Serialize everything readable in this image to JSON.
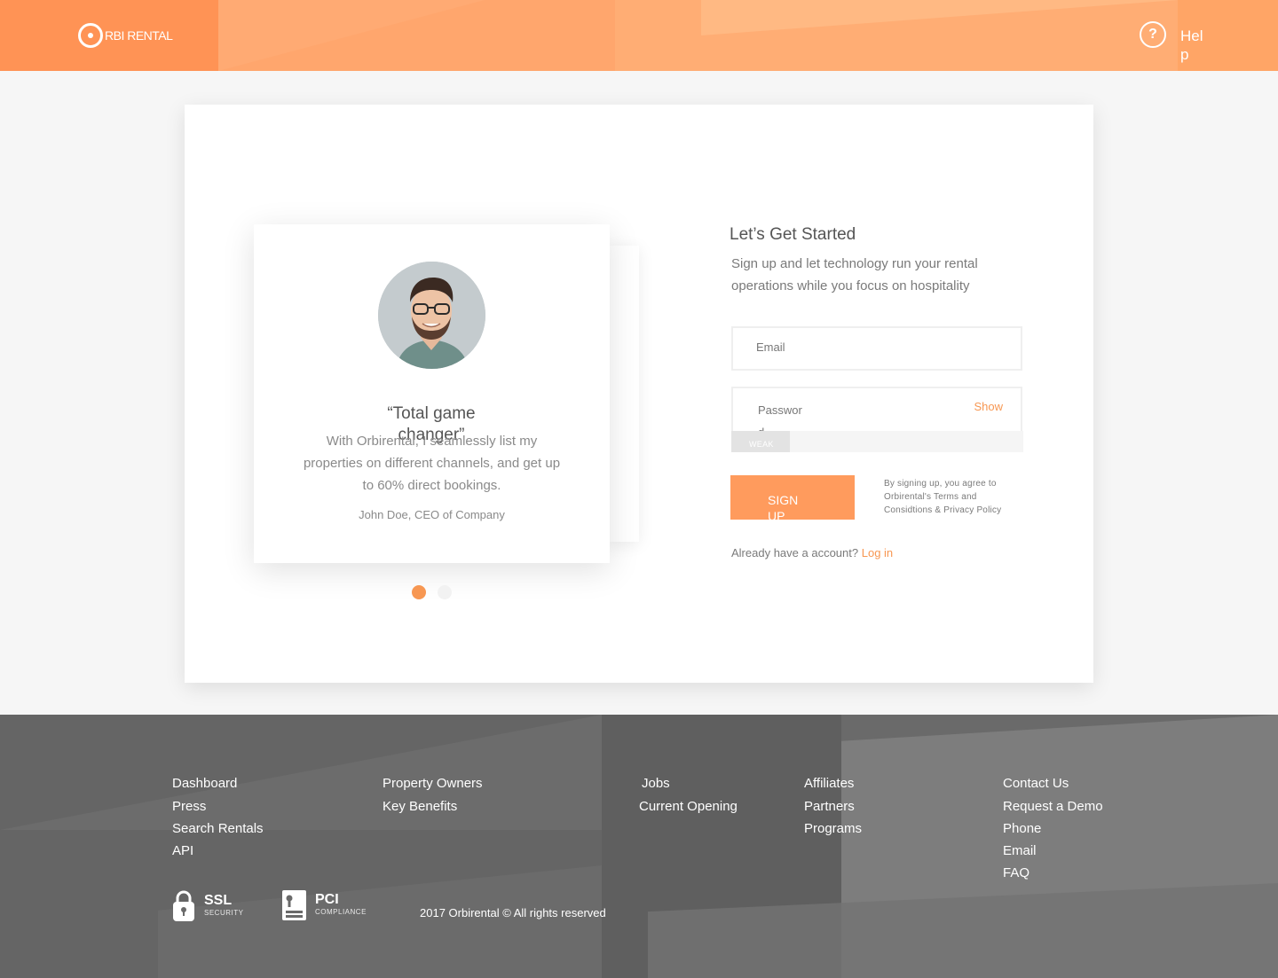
{
  "header": {
    "logo_text": "RBI RENTAL",
    "help_label": "Help"
  },
  "testimonial": {
    "quote_title": "“Total game changer”",
    "quote_body": "With Orbirental, I seamlessly list my properties on different channels, and get up to 60% direct bookings.",
    "author": "John Doe, CEO of Company",
    "slides_total": 2,
    "active_slide": 1
  },
  "form": {
    "title": "Let’s Get Started",
    "subtitle": "Sign up and let technology run your rental operations while you focus on hospitality",
    "email_placeholder": "Email",
    "password_placeholder": "Password",
    "show_label": "Show",
    "strength_label": "WEAK",
    "strength_level": 0.2,
    "signup_label": "SIGN UP",
    "terms": "By signing up, you agree to Orbirental's Terms and Considtions & Privacy Policy",
    "login_prompt": "Already have a account?",
    "login_link": "Log in"
  },
  "footer": {
    "columns": [
      [
        "Dashboard",
        "Press",
        "Search Rentals",
        "API"
      ],
      [
        "Property Owners",
        "Key Benefits"
      ],
      [
        "Jobs",
        "Current Opening"
      ],
      [
        "Affiliates",
        "Partners",
        "Programs"
      ],
      [
        "Contact Us",
        "Request a Demo",
        "Phone",
        "Email",
        "FAQ"
      ]
    ],
    "badges": {
      "ssl_title": "SSL",
      "ssl_sub": "SECURITY",
      "pci_title": "PCI",
      "pci_sub": "COMPLIANCE"
    },
    "copyright": "2017 Orbirental © All rights reserved"
  },
  "colors": {
    "accent": "#f79752",
    "header": "#ff9a5a",
    "footer": "#6a6a6a"
  }
}
